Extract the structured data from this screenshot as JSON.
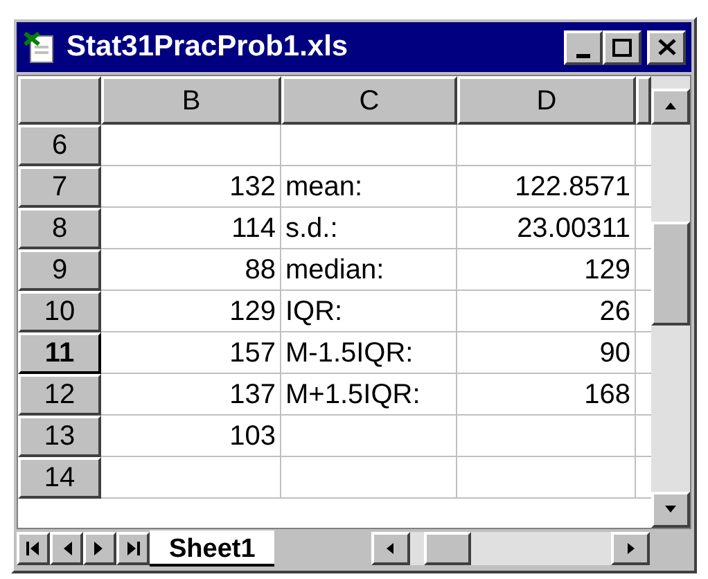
{
  "window": {
    "title": "Stat31PracProb1.xls"
  },
  "columns": [
    "B",
    "C",
    "D"
  ],
  "rows": [
    {
      "header": "6",
      "selected": false,
      "cells": [
        null,
        null,
        null
      ]
    },
    {
      "header": "7",
      "selected": false,
      "cells": [
        "132",
        "mean:",
        "122.8571"
      ]
    },
    {
      "header": "8",
      "selected": false,
      "cells": [
        "114",
        "s.d.:",
        "23.00311"
      ]
    },
    {
      "header": "9",
      "selected": false,
      "cells": [
        "88",
        "median:",
        "129"
      ]
    },
    {
      "header": "10",
      "selected": false,
      "cells": [
        "129",
        "IQR:",
        "26"
      ]
    },
    {
      "header": "11",
      "selected": true,
      "cells": [
        "157",
        "M-1.5IQR:",
        "90"
      ]
    },
    {
      "header": "12",
      "selected": false,
      "cells": [
        "137",
        "M+1.5IQR:",
        "168"
      ]
    },
    {
      "header": "13",
      "selected": false,
      "cells": [
        "103",
        null,
        null
      ]
    },
    {
      "header": "14",
      "selected": false,
      "cells": [
        null,
        null,
        null
      ]
    }
  ],
  "sheet_tabs": [
    {
      "label": "Sheet1",
      "selected": true
    }
  ]
}
